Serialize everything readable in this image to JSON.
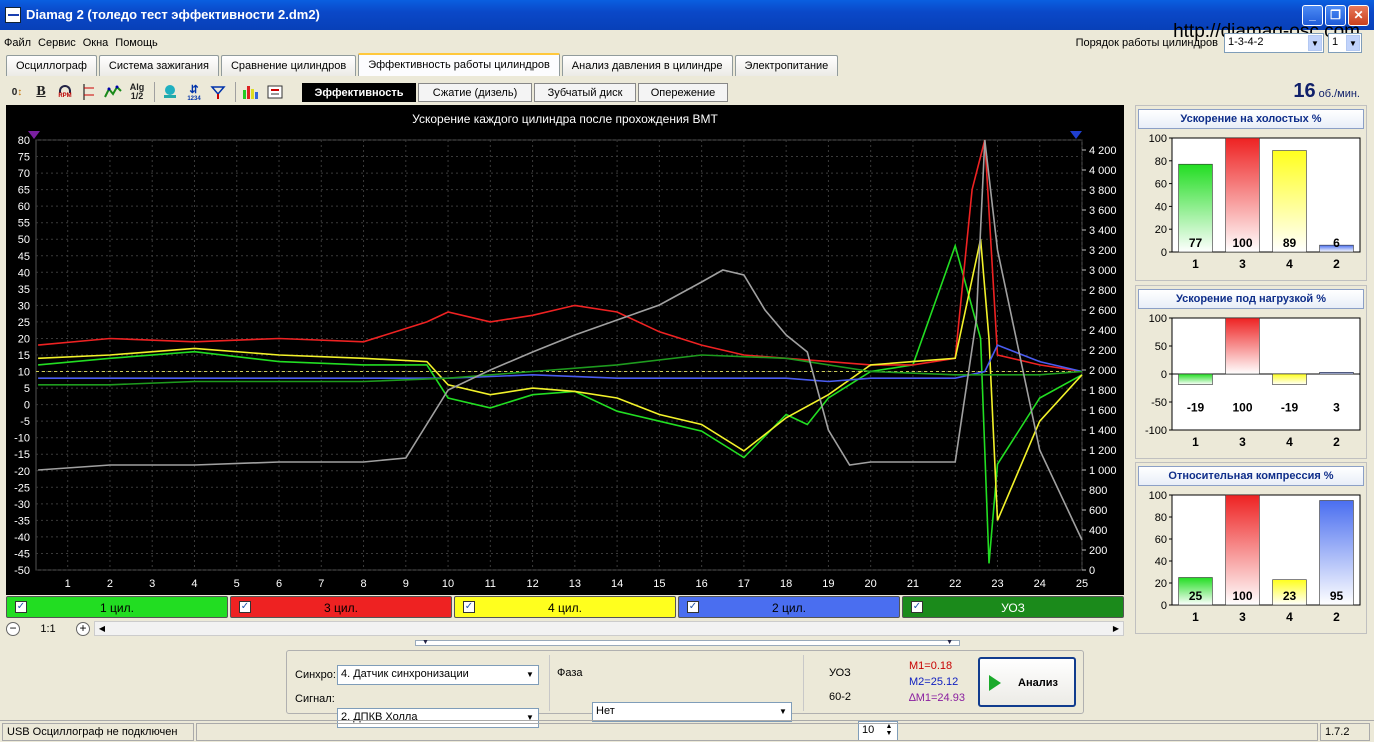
{
  "window": {
    "title": "Diamag 2 (толедо тест эффективности 2.dm2)",
    "watermark": "http://diamag-osc.com"
  },
  "menu": [
    "Файл",
    "Сервис",
    "Окна",
    "Помощь"
  ],
  "firing_order": {
    "label": "Порядок работы цилиндров",
    "value": "1-3-4-2",
    "cylinder": "1"
  },
  "tabs": [
    "Осциллограф",
    "Система зажигания",
    "Сравнение цилиндров",
    "Эффективность работы цилиндров",
    "Анализ давления в цилиндре",
    "Электропитание"
  ],
  "active_tab": 3,
  "toolbar_icons": [
    "zero-shift-icon",
    "bold-icon",
    "rpm-icon",
    "scale-icon",
    "smooth-icon",
    "alg-icon",
    "filter-icon",
    "sync-icon",
    "marker-icon",
    "bars-icon",
    "export-icon"
  ],
  "toolbar_text": {
    "zero": "0",
    "bold": "B",
    "alg_top": "Alg",
    "alg_bottom": "1/2",
    "rpm_label": "RPM",
    "counter": "1234"
  },
  "subtabs": [
    "Эффективность",
    "Сжатие (дизель)",
    "Зубчатый диск",
    "Опережение"
  ],
  "rpm": {
    "value": "16",
    "unit": "об./мин."
  },
  "chart_data": {
    "type": "line",
    "title": "Ускорение каждого цилиндра после прохождения ВМТ",
    "ylim": [
      -50,
      80
    ],
    "y_ticks": [
      80,
      75,
      70,
      65,
      60,
      55,
      50,
      45,
      40,
      35,
      30,
      25,
      20,
      15,
      10,
      5,
      0,
      -5,
      -10,
      -15,
      -20,
      -25,
      -30,
      -35,
      -40,
      -45,
      -50
    ],
    "y2lim": [
      0,
      4300
    ],
    "y2_ticks": [
      "4 200",
      "4 000",
      "3 800",
      "3 600",
      "3 400",
      "3 200",
      "3 000",
      "2 800",
      "2 600",
      "2 400",
      "2 200",
      "2 000",
      "1 800",
      "1 600",
      "1 400",
      "1 200",
      "1 000",
      "800",
      "600",
      "400",
      "200",
      "0"
    ],
    "x_ticks": [
      1,
      2,
      3,
      4,
      5,
      6,
      7,
      8,
      9,
      10,
      11,
      12,
      13,
      14,
      15,
      16,
      17,
      18,
      19,
      20,
      21,
      22,
      23,
      24,
      25
    ],
    "xlim": [
      0.25,
      25
    ],
    "grid": true,
    "series": [
      {
        "name": "1 цил.",
        "color": "#22DD22",
        "x": [
          0.3,
          2,
          4,
          6,
          8,
          9.5,
          10,
          11,
          12,
          13,
          14,
          15,
          16,
          17,
          18,
          18.5,
          19,
          20,
          21,
          22,
          22.6,
          22.8,
          23,
          24,
          25
        ],
        "y": [
          12,
          14,
          16,
          13,
          12,
          12,
          2,
          -1,
          3,
          4,
          -2,
          -5,
          -8,
          -16,
          -3,
          -6,
          2,
          10,
          12,
          48,
          20,
          -48,
          -18,
          2,
          9
        ]
      },
      {
        "name": "3 цил.",
        "color": "#EE2222",
        "x": [
          0.3,
          2,
          4,
          6,
          8,
          9.5,
          10,
          11,
          12,
          13,
          14,
          15,
          16,
          17,
          18,
          19,
          20,
          21,
          22,
          22.4,
          22.7,
          23,
          24,
          25
        ],
        "y": [
          18,
          20,
          19,
          20,
          19,
          25,
          28,
          25,
          27,
          30,
          28,
          22,
          18,
          15,
          14,
          13,
          12,
          12,
          14,
          65,
          80,
          15,
          12,
          10
        ]
      },
      {
        "name": "4 цил.",
        "color": "#F2F22A",
        "x": [
          0.3,
          2,
          4,
          6,
          8,
          9.5,
          10,
          11,
          12,
          13,
          14,
          15,
          16,
          17,
          18,
          19,
          20,
          21,
          22,
          22.6,
          22.8,
          23,
          24,
          25
        ],
        "y": [
          14,
          15,
          17,
          15,
          14,
          13,
          6,
          3,
          5,
          4,
          2,
          -3,
          -6,
          -14,
          -4,
          3,
          12,
          13,
          14,
          50,
          20,
          -35,
          -5,
          9
        ]
      },
      {
        "name": "2 цил.",
        "color": "#4A5CF0",
        "x": [
          0.3,
          2,
          4,
          6,
          8,
          10,
          12,
          14,
          16,
          18,
          19,
          20,
          21,
          22,
          22.7,
          23,
          24,
          25
        ],
        "y": [
          8,
          8,
          8,
          8,
          8,
          8,
          9,
          8,
          8,
          8,
          7,
          8,
          8,
          8,
          10,
          18,
          13,
          10
        ]
      },
      {
        "name": "УОЗ",
        "color": "#1E9B1E",
        "x": [
          0.3,
          2,
          4,
          6,
          8,
          10,
          12,
          14,
          16,
          18,
          20,
          22,
          23,
          24,
          25
        ],
        "y": [
          6,
          6,
          7,
          7,
          7,
          8,
          10,
          12,
          15,
          14,
          10,
          9,
          9,
          9,
          10
        ]
      },
      {
        "name": "RPM",
        "color": "#A0A0A0",
        "axis": "y2",
        "x": [
          0.3,
          2,
          4,
          6,
          8,
          9,
          10,
          11,
          12,
          13,
          14,
          15,
          16,
          16.5,
          17,
          17.5,
          18,
          18.5,
          19,
          19.5,
          20,
          21,
          22,
          22.5,
          22.7,
          23,
          24,
          25
        ],
        "y": [
          1000,
          1050,
          1050,
          1080,
          1080,
          1120,
          1800,
          2000,
          2180,
          2350,
          2500,
          2650,
          2880,
          3000,
          2950,
          2600,
          2350,
          2180,
          1400,
          1050,
          1080,
          1080,
          1080,
          2500,
          4300,
          3200,
          1200,
          300
        ]
      }
    ]
  },
  "legend": [
    {
      "label": "1 цил.",
      "color": "#22DD22"
    },
    {
      "label": "3 цил.",
      "color": "#EE2222"
    },
    {
      "label": "4 цил.",
      "color": "#FFFF1E"
    },
    {
      "label": "2 цил.",
      "color": "#4A6EF0"
    },
    {
      "label": "УОЗ",
      "color": "#1B8A1B"
    }
  ],
  "zoom": "1:1",
  "panels": [
    {
      "title": "Ускорение на холостых %",
      "ymin": 0,
      "ymax": 100,
      "y_ticks": [
        100,
        80,
        60,
        40,
        20,
        0
      ],
      "bars": [
        {
          "cyl": "1",
          "value": 77,
          "color": "#22DD22"
        },
        {
          "cyl": "3",
          "value": 100,
          "color": "#EE2222"
        },
        {
          "cyl": "4",
          "value": 89,
          "color": "#FFFF1E"
        },
        {
          "cyl": "2",
          "value": 6,
          "color": "#4A6EF0"
        }
      ]
    },
    {
      "title": "Ускорение под нагрузкой %",
      "ymin": -100,
      "ymax": 100,
      "y_ticks": [
        100,
        50,
        0,
        -50,
        -100
      ],
      "bars": [
        {
          "cyl": "1",
          "value": -19,
          "color": "#22DD22"
        },
        {
          "cyl": "3",
          "value": 100,
          "color": "#EE2222"
        },
        {
          "cyl": "4",
          "value": -19,
          "color": "#FFFF1E"
        },
        {
          "cyl": "2",
          "value": 3,
          "color": "#4A6EF0"
        }
      ]
    },
    {
      "title": "Относительная компрессия %",
      "ymin": 0,
      "ymax": 100,
      "y_ticks": [
        100,
        80,
        60,
        40,
        20,
        0
      ],
      "bars": [
        {
          "cyl": "1",
          "value": 25,
          "color": "#22DD22"
        },
        {
          "cyl": "3",
          "value": 100,
          "color": "#EE2222"
        },
        {
          "cyl": "4",
          "value": 23,
          "color": "#FFFF1E"
        },
        {
          "cyl": "2",
          "value": 95,
          "color": "#4A6EF0"
        }
      ]
    }
  ],
  "controls": {
    "sync_label": "Синхро:",
    "sync_value": "4.  Датчик синхронизации",
    "signal_label": "Сигнал:",
    "signal_value": "2.  ДПКВ Холла",
    "phase_label": "Фаза",
    "phase_value": "Нет",
    "uoz_label": "УОЗ",
    "uoz_value": "10",
    "teeth": "60-2",
    "m1": "M1=0.18",
    "m2": "M2=25.12",
    "dm1": "∆M1=24.93",
    "analyze": "Анализ"
  },
  "status": {
    "left": "USB Осциллограф не подключен",
    "version": "1.7.2"
  }
}
